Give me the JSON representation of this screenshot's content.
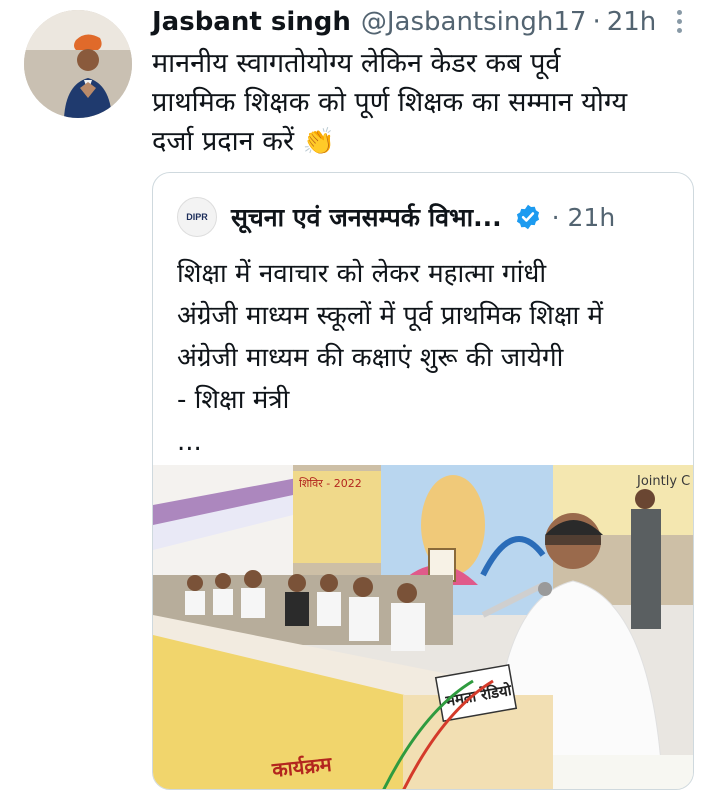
{
  "tweet": {
    "author_name": "Jasbant singh",
    "handle": "@Jasbantsingh17",
    "separator": "·",
    "time": "21h",
    "text_lines": [
      "माननीय स्वागतोयोग्य लेकिन केडर कब पूर्व",
      "प्राथमिक शिक्षक को पूर्ण शिक्षक का सम्मान योग्य",
      "दर्जा प्रदान करें"
    ],
    "emoji": "👏",
    "more_icon": "more-vertical-icon"
  },
  "quoted_tweet": {
    "author_name": "सूचना एवं जनसम्पर्क विभा...",
    "avatar_text": "DIPR",
    "verified_icon": "verified-badge-icon",
    "separator": "·",
    "time": "21h",
    "text_lines": [
      "शिक्षा में नवाचार को लेकर महात्मा गांधी",
      "अंग्रेजी माध्यम स्कूलों में पूर्व प्राथमिक शिक्षा में",
      "अंग्रेजी माध्यम की कक्षाएं शुरू की जायेगी",
      "- शिक्षा मंत्री",
      "..."
    ],
    "photo": {
      "banner_left": "शिविर - 2022",
      "banner_right": "Jointly C",
      "podium_sign": "ममता रेडियो",
      "table_banner": "कार्यक्रम"
    }
  },
  "colors": {
    "text_primary": "#0f1419",
    "text_secondary": "#536471",
    "verified_blue": "#1d9bf0",
    "border": "#cfd9de"
  }
}
